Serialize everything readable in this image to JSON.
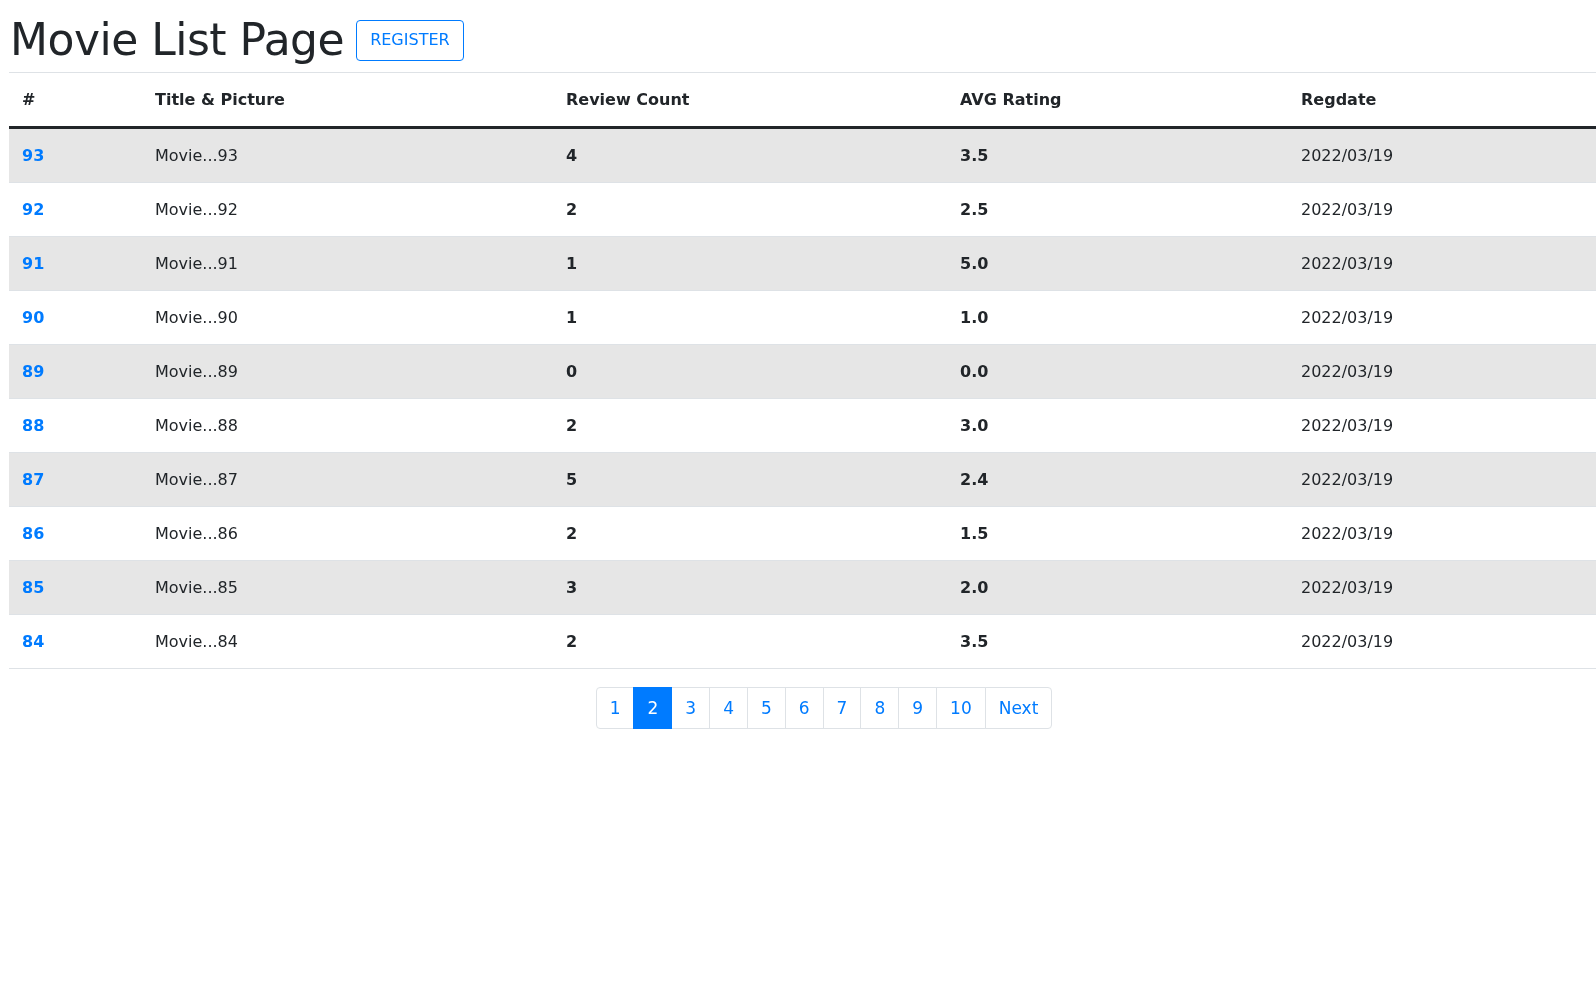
{
  "title": "Movie List Page",
  "register_button": "REGISTER",
  "table": {
    "columns": [
      "#",
      "Title & Picture",
      "Review Count",
      "AVG Rating",
      "Regdate"
    ],
    "rows": [
      {
        "id": "93",
        "title": "Movie...93",
        "review_count": "4",
        "avg_rating": "3.5",
        "regdate": "2022/03/19"
      },
      {
        "id": "92",
        "title": "Movie...92",
        "review_count": "2",
        "avg_rating": "2.5",
        "regdate": "2022/03/19"
      },
      {
        "id": "91",
        "title": "Movie...91",
        "review_count": "1",
        "avg_rating": "5.0",
        "regdate": "2022/03/19"
      },
      {
        "id": "90",
        "title": "Movie...90",
        "review_count": "1",
        "avg_rating": "1.0",
        "regdate": "2022/03/19"
      },
      {
        "id": "89",
        "title": "Movie...89",
        "review_count": "0",
        "avg_rating": "0.0",
        "regdate": "2022/03/19"
      },
      {
        "id": "88",
        "title": "Movie...88",
        "review_count": "2",
        "avg_rating": "3.0",
        "regdate": "2022/03/19"
      },
      {
        "id": "87",
        "title": "Movie...87",
        "review_count": "5",
        "avg_rating": "2.4",
        "regdate": "2022/03/19"
      },
      {
        "id": "86",
        "title": "Movie...86",
        "review_count": "2",
        "avg_rating": "1.5",
        "regdate": "2022/03/19"
      },
      {
        "id": "85",
        "title": "Movie...85",
        "review_count": "3",
        "avg_rating": "2.0",
        "regdate": "2022/03/19"
      },
      {
        "id": "84",
        "title": "Movie...84",
        "review_count": "2",
        "avg_rating": "3.5",
        "regdate": "2022/03/19"
      }
    ]
  },
  "pagination": [
    {
      "label": "1",
      "selected": false
    },
    {
      "label": "2",
      "selected": true
    },
    {
      "label": "3",
      "selected": false
    },
    {
      "label": "4",
      "selected": false
    },
    {
      "label": "5",
      "selected": false
    },
    {
      "label": "6",
      "selected": false
    },
    {
      "label": "7",
      "selected": false
    },
    {
      "label": "8",
      "selected": false
    },
    {
      "label": "9",
      "selected": false
    },
    {
      "label": "10",
      "selected": false
    },
    {
      "label": "Next",
      "selected": false
    }
  ]
}
